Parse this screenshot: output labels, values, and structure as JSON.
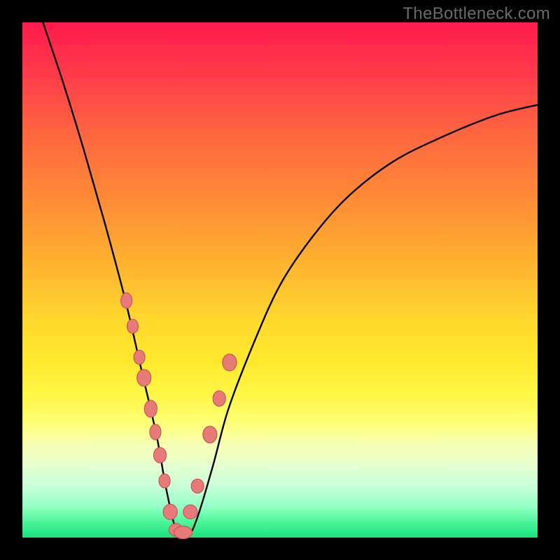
{
  "watermark": "TheBottleneck.com",
  "colors": {
    "frame": "#000000",
    "dot_fill": "#e77b79",
    "dot_stroke": "#c95552",
    "curve": "#000000"
  },
  "chart_data": {
    "type": "line",
    "title": "",
    "xlabel": "",
    "ylabel": "",
    "xlim": [
      0,
      100
    ],
    "ylim": [
      0,
      100
    ],
    "grid": false,
    "legend": false,
    "notes": "V-shaped bottleneck curve over red→yellow→green vertical gradient. Minimum of curve near x≈30, y≈0. Axes have no ticks or labels. Y value ≈ mismatch %, x ≈ relative component performance.",
    "series": [
      {
        "name": "bottleneck-curve",
        "x": [
          4,
          8,
          12,
          16,
          20,
          23,
          26,
          28,
          30,
          32,
          34,
          37,
          40,
          45,
          50,
          56,
          63,
          72,
          82,
          92,
          100
        ],
        "y": [
          100,
          88,
          75,
          61,
          46,
          33,
          20,
          9,
          1,
          0,
          4,
          14,
          25,
          38,
          49,
          58,
          66,
          73,
          78,
          82,
          84
        ]
      }
    ],
    "markers": {
      "name": "highlight-dots",
      "note": "pink beads along both arms of the V near the bottom",
      "x": [
        20.2,
        21.4,
        22.7,
        23.6,
        24.9,
        25.8,
        26.7,
        27.6,
        28.7,
        29.8,
        31.2,
        32.6,
        34.0,
        36.4,
        38.2,
        40.2
      ],
      "y": [
        46.0,
        41.0,
        35.0,
        31.0,
        25.0,
        20.5,
        16.0,
        11.0,
        5.0,
        1.5,
        1.0,
        5.0,
        10.0,
        20.0,
        27.0,
        34.0
      ],
      "rx": [
        8,
        8,
        8,
        10,
        9,
        8,
        9,
        8,
        10,
        10,
        13,
        10,
        9,
        10,
        9,
        10
      ],
      "ry": [
        11,
        10,
        10,
        12,
        12,
        11,
        11,
        10,
        11,
        9,
        9,
        10,
        10,
        12,
        11,
        12
      ]
    }
  }
}
